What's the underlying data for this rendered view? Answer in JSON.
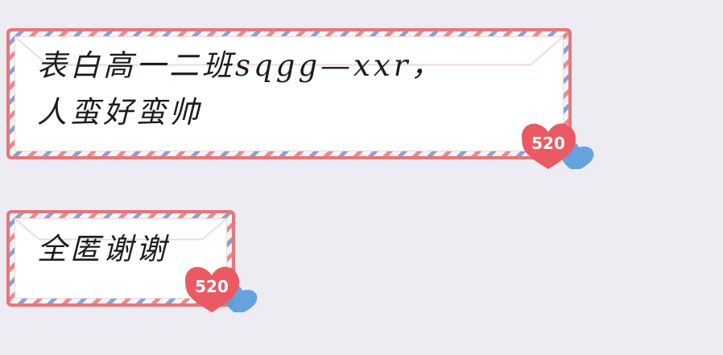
{
  "messages": [
    {
      "text": "表白高一二班sqgg—xxr，\n人蛮好蛮帅",
      "badge": "520"
    },
    {
      "text": "全匿谢谢",
      "badge": "520"
    }
  ],
  "colors": {
    "background": "#ececf2",
    "bubble_border": "#e5767b",
    "stripe_blue": "#8aa3cf",
    "stripe_red": "#e88a8f",
    "heart_red": "#ea5a63",
    "heart_blue": "#5f9fdc"
  },
  "icons": {
    "badge_heart": "heart-icon",
    "badge_small_heart": "small-heart-icon"
  }
}
